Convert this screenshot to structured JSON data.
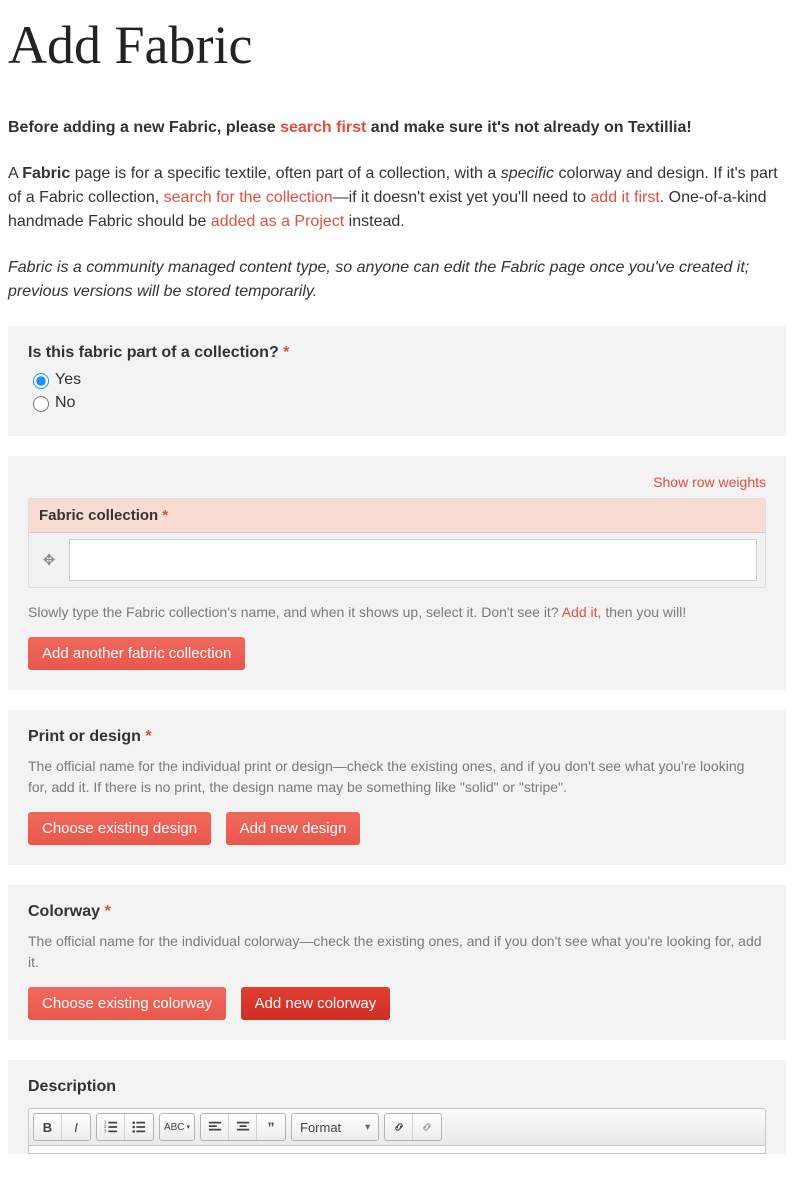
{
  "page_title": "Add Fabric",
  "intro": {
    "p1_parts": {
      "before": "Before adding a new Fabric, please ",
      "link1": "search first",
      "after": " and make sure it's not already on Textillia!"
    },
    "p2_parts": {
      "t1": "A ",
      "bold1": "Fabric",
      "t2": " page is for a specific textile, often part of a collection, with a ",
      "italic1": "specific",
      "t3": " colorway and design. If it's part of a Fabric collection, ",
      "link1": "search for the collection",
      "t4": "—if it doesn't exist yet you'll need to ",
      "link2": "add it first",
      "t5": ". One-of-a-kind handmade Fabric should be ",
      "link3": "added as a Project",
      "t6": " instead."
    },
    "p3": "Fabric is a community managed content type, so anyone can edit the Fabric page once you've created it; previous versions will be stored temporarily."
  },
  "collection_q": {
    "label": "Is this fabric part of a collection?",
    "opt_yes": "Yes",
    "opt_no": "No"
  },
  "collection_panel": {
    "show_weights": "Show row weights",
    "header": "Fabric collection",
    "help_before": "Slowly type the Fabric collection's name, and when it shows up, select it. Don't see it? ",
    "help_link": "Add it",
    "help_after": ", then you will!",
    "add_btn": "Add another fabric collection"
  },
  "design_panel": {
    "label": "Print or design",
    "help": "The official name for the individual print or design—check the existing ones, and if you don't see what you're looking for, add it. If there is no print, the design name may be something like \"solid\" or \"stripe\".",
    "btn_choose": "Choose existing design",
    "btn_add": "Add new design"
  },
  "colorway_panel": {
    "label": "Colorway",
    "help": "The official name for the individual colorway—check the existing ones, and if you don't see what you're looking for, add it.",
    "btn_choose": "Choose existing colorway",
    "btn_add": "Add new colorway"
  },
  "description_panel": {
    "label": "Description",
    "toolbar": {
      "format": "Format"
    }
  }
}
